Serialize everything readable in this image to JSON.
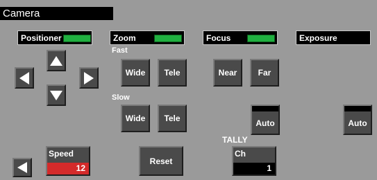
{
  "window": {
    "title": "Camera"
  },
  "sections": {
    "positioner": {
      "label": "Positioner"
    },
    "zoom": {
      "label": "Zoom"
    },
    "focus": {
      "label": "Focus"
    },
    "exposure": {
      "label": "Exposure"
    }
  },
  "zoom": {
    "fast_label": "Fast",
    "slow_label": "Slow",
    "fast_wide": "Wide",
    "fast_tele": "Tele",
    "slow_wide": "Wide",
    "slow_tele": "Tele"
  },
  "focus": {
    "near": "Near",
    "far": "Far",
    "auto": "Auto"
  },
  "exposure": {
    "auto": "Auto"
  },
  "speed": {
    "label": "Speed",
    "value": "12"
  },
  "reset": {
    "label": "Reset"
  },
  "tally": {
    "label": "TALLY",
    "ch_label": "Ch",
    "ch_value": "1"
  },
  "colors": {
    "led_green": "#20b040",
    "speed_red": "#d42a2a",
    "background": "#9a9a9a"
  }
}
